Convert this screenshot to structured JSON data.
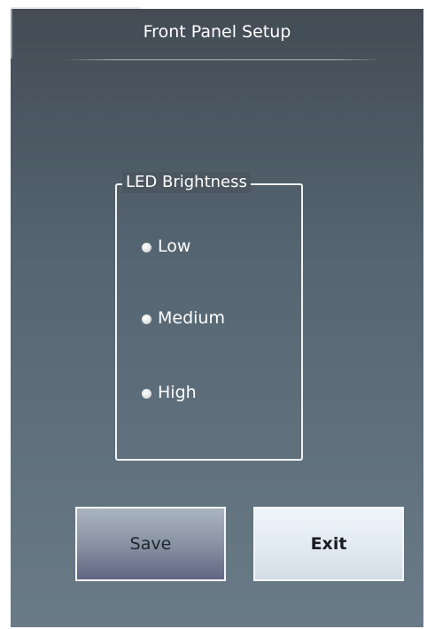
{
  "header": {
    "title": "Front Panel Setup"
  },
  "led_group": {
    "legend": "LED Brightness",
    "options": [
      {
        "label": "Low"
      },
      {
        "label": "Medium"
      },
      {
        "label": "High"
      }
    ]
  },
  "actions": {
    "save_label": "Save",
    "exit_label": "Exit"
  },
  "colors": {
    "panel_top": "#434c55",
    "panel_bottom": "#6a7b88",
    "save_button": "#858fa0",
    "exit_button": "#e0e9f1"
  },
  "icons": {
    "radio": "radio-button-icon"
  }
}
